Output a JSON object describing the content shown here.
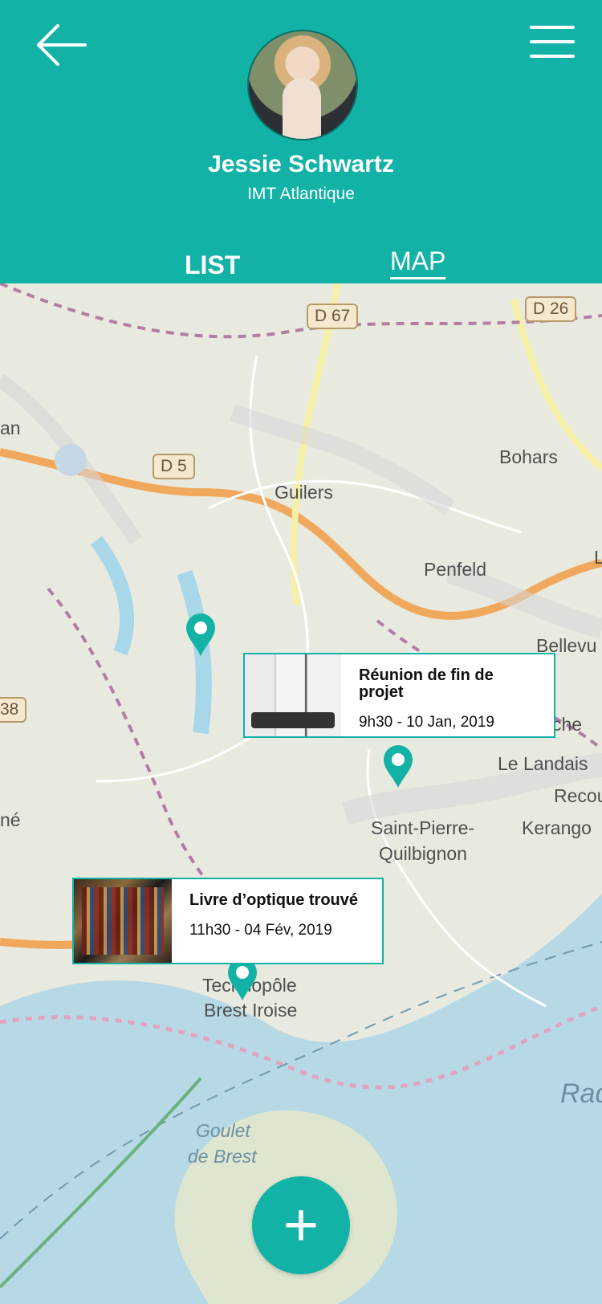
{
  "header": {
    "name": "Jessie Schwartz",
    "organization": "IMT Atlantique",
    "tabs": [
      {
        "label": "LIST",
        "active": false
      },
      {
        "label": "MAP",
        "active": true
      }
    ],
    "icons": {
      "back": "arrow-left-icon",
      "menu": "hamburger-menu-icon"
    },
    "colors": {
      "accent": "#13b2a6"
    }
  },
  "map": {
    "road_labels": [
      "D 67",
      "D 26",
      "D 5"
    ],
    "places": [
      "Bohars",
      "Guilers",
      "Penfeld",
      "Bellevu",
      "La Cavale Blanche",
      "Le Landais",
      "Recou",
      "Saint-Pierre-",
      "Quilbignon",
      "Kerango",
      "Technopôle",
      "Brest Iroise",
      "Goulet",
      "de Brest",
      "Rad",
      "an",
      "né",
      "38",
      "L"
    ],
    "events": [
      {
        "title": "Réunion de fin de projet",
        "date": "9h30  -  10 Jan, 2019",
        "image": "meeting-photo"
      },
      {
        "title": "Livre d’optique trouvé",
        "date": "11h30  -  04 Fév, 2019",
        "image": "bookshelf-photo"
      }
    ]
  },
  "actions": {
    "add_label": "+"
  }
}
